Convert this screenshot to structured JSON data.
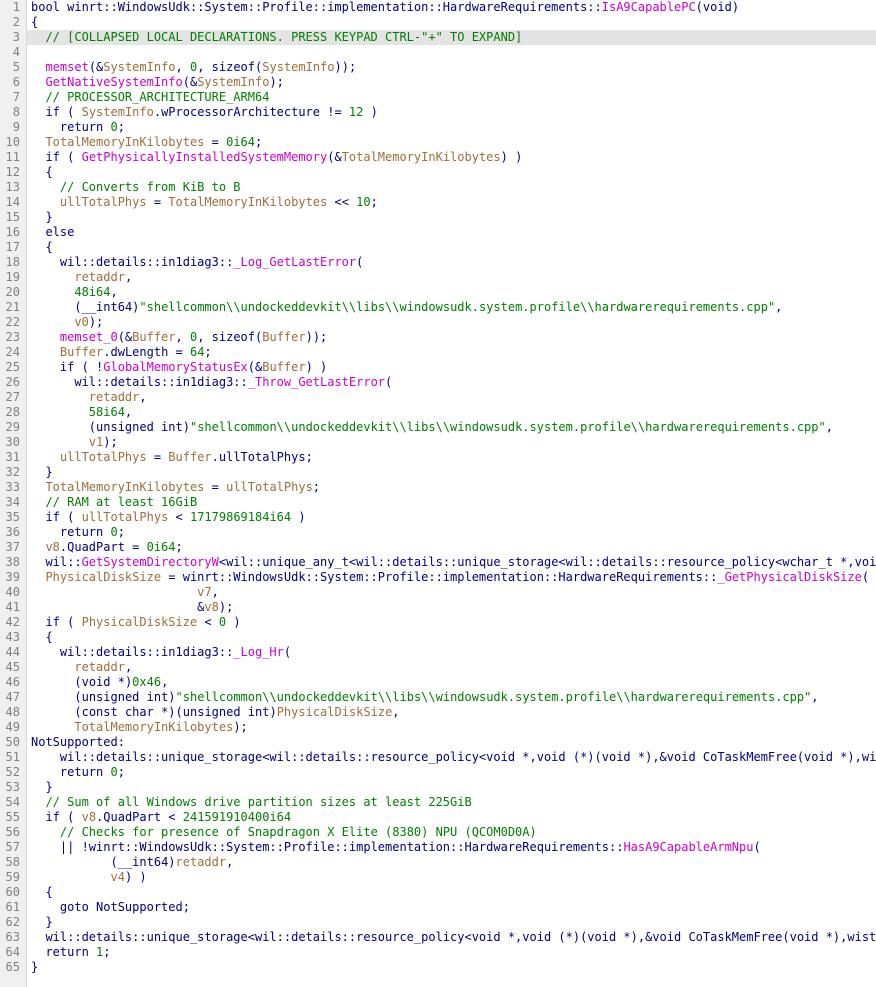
{
  "total_line_count": 65,
  "collapsed_line": 3,
  "lines": [
    {
      "n": 1,
      "ind": 0,
      "tokens": [
        {
          "t": "kw",
          "v": "bool "
        },
        {
          "t": "pl",
          "v": "winrt::WindowsUdk::System::Profile::implementation::HardwareRequirements::"
        },
        {
          "t": "fn",
          "v": "IsA9CapablePC"
        },
        {
          "t": "pl",
          "v": "("
        },
        {
          "t": "kw",
          "v": "void"
        },
        {
          "t": "pl",
          "v": ")"
        }
      ]
    },
    {
      "n": 2,
      "ind": 0,
      "tokens": [
        {
          "t": "pl",
          "v": "{"
        }
      ]
    },
    {
      "n": 3,
      "ind": 1,
      "collapsed": true,
      "tokens": [
        {
          "t": "cmt",
          "v": "// [COLLAPSED LOCAL DECLARATIONS. PRESS KEYPAD CTRL-\"+\" TO EXPAND]"
        }
      ]
    },
    {
      "n": 4,
      "ind": 0,
      "tokens": []
    },
    {
      "n": 5,
      "ind": 1,
      "tokens": [
        {
          "t": "fn",
          "v": "memset"
        },
        {
          "t": "pl",
          "v": "(&"
        },
        {
          "t": "var",
          "v": "SystemInfo"
        },
        {
          "t": "pl",
          "v": ", "
        },
        {
          "t": "num",
          "v": "0"
        },
        {
          "t": "pl",
          "v": ", "
        },
        {
          "t": "kw",
          "v": "sizeof"
        },
        {
          "t": "pl",
          "v": "("
        },
        {
          "t": "var",
          "v": "SystemInfo"
        },
        {
          "t": "pl",
          "v": "));"
        }
      ]
    },
    {
      "n": 6,
      "ind": 1,
      "tokens": [
        {
          "t": "fn",
          "v": "GetNativeSystemInfo"
        },
        {
          "t": "pl",
          "v": "(&"
        },
        {
          "t": "var",
          "v": "SystemInfo"
        },
        {
          "t": "pl",
          "v": ");"
        }
      ]
    },
    {
      "n": 7,
      "ind": 1,
      "tokens": [
        {
          "t": "cmt",
          "v": "// PROCESSOR_ARCHITECTURE_ARM64"
        }
      ]
    },
    {
      "n": 8,
      "ind": 1,
      "tokens": [
        {
          "t": "kw",
          "v": "if "
        },
        {
          "t": "pl",
          "v": "( "
        },
        {
          "t": "var",
          "v": "SystemInfo"
        },
        {
          "t": "pl",
          "v": ".wProcessorArchitecture != "
        },
        {
          "t": "num",
          "v": "12"
        },
        {
          "t": "pl",
          "v": " )"
        }
      ]
    },
    {
      "n": 9,
      "ind": 2,
      "tokens": [
        {
          "t": "kw",
          "v": "return "
        },
        {
          "t": "num",
          "v": "0"
        },
        {
          "t": "pl",
          "v": ";"
        }
      ]
    },
    {
      "n": 10,
      "ind": 1,
      "tokens": [
        {
          "t": "var",
          "v": "TotalMemoryInKilobytes"
        },
        {
          "t": "pl",
          "v": " = "
        },
        {
          "t": "num",
          "v": "0i64"
        },
        {
          "t": "pl",
          "v": ";"
        }
      ]
    },
    {
      "n": 11,
      "ind": 1,
      "tokens": [
        {
          "t": "kw",
          "v": "if "
        },
        {
          "t": "pl",
          "v": "( "
        },
        {
          "t": "fn",
          "v": "GetPhysicallyInstalledSystemMemory"
        },
        {
          "t": "pl",
          "v": "(&"
        },
        {
          "t": "var",
          "v": "TotalMemoryInKilobytes"
        },
        {
          "t": "pl",
          "v": ") )"
        }
      ]
    },
    {
      "n": 12,
      "ind": 1,
      "tokens": [
        {
          "t": "pl",
          "v": "{"
        }
      ]
    },
    {
      "n": 13,
      "ind": 2,
      "tokens": [
        {
          "t": "cmt",
          "v": "// Converts from KiB to B"
        }
      ]
    },
    {
      "n": 14,
      "ind": 2,
      "tokens": [
        {
          "t": "var",
          "v": "ullTotalPhys"
        },
        {
          "t": "pl",
          "v": " = "
        },
        {
          "t": "var",
          "v": "TotalMemoryInKilobytes"
        },
        {
          "t": "pl",
          "v": " << "
        },
        {
          "t": "num",
          "v": "10"
        },
        {
          "t": "pl",
          "v": ";"
        }
      ]
    },
    {
      "n": 15,
      "ind": 1,
      "tokens": [
        {
          "t": "pl",
          "v": "}"
        }
      ]
    },
    {
      "n": 16,
      "ind": 1,
      "tokens": [
        {
          "t": "kw",
          "v": "else"
        }
      ]
    },
    {
      "n": 17,
      "ind": 1,
      "tokens": [
        {
          "t": "pl",
          "v": "{"
        }
      ]
    },
    {
      "n": 18,
      "ind": 2,
      "tokens": [
        {
          "t": "pl",
          "v": "wil::details::in1diag3::"
        },
        {
          "t": "fn",
          "v": "_Log_GetLastError"
        },
        {
          "t": "pl",
          "v": "("
        }
      ]
    },
    {
      "n": 19,
      "ind": 3,
      "tokens": [
        {
          "t": "var",
          "v": "retaddr"
        },
        {
          "t": "pl",
          "v": ","
        }
      ]
    },
    {
      "n": 20,
      "ind": 3,
      "tokens": [
        {
          "t": "num",
          "v": "48i64"
        },
        {
          "t": "pl",
          "v": ","
        }
      ]
    },
    {
      "n": 21,
      "ind": 3,
      "tokens": [
        {
          "t": "pl",
          "v": "("
        },
        {
          "t": "type",
          "v": "__int64"
        },
        {
          "t": "pl",
          "v": ")"
        },
        {
          "t": "str",
          "v": "\"shellcommon\\\\undockeddevkit\\\\libs\\\\windowsudk.system.profile\\\\hardwarerequirements.cpp\""
        },
        {
          "t": "pl",
          "v": ","
        }
      ]
    },
    {
      "n": 22,
      "ind": 3,
      "tokens": [
        {
          "t": "var",
          "v": "v0"
        },
        {
          "t": "pl",
          "v": ");"
        }
      ]
    },
    {
      "n": 23,
      "ind": 2,
      "tokens": [
        {
          "t": "fn",
          "v": "memset_0"
        },
        {
          "t": "pl",
          "v": "(&"
        },
        {
          "t": "var",
          "v": "Buffer"
        },
        {
          "t": "pl",
          "v": ", "
        },
        {
          "t": "num",
          "v": "0"
        },
        {
          "t": "pl",
          "v": ", "
        },
        {
          "t": "kw",
          "v": "sizeof"
        },
        {
          "t": "pl",
          "v": "("
        },
        {
          "t": "var",
          "v": "Buffer"
        },
        {
          "t": "pl",
          "v": "));"
        }
      ]
    },
    {
      "n": 24,
      "ind": 2,
      "tokens": [
        {
          "t": "var",
          "v": "Buffer"
        },
        {
          "t": "pl",
          "v": ".dwLength = "
        },
        {
          "t": "num",
          "v": "64"
        },
        {
          "t": "pl",
          "v": ";"
        }
      ]
    },
    {
      "n": 25,
      "ind": 2,
      "tokens": [
        {
          "t": "kw",
          "v": "if "
        },
        {
          "t": "pl",
          "v": "( !"
        },
        {
          "t": "fn",
          "v": "GlobalMemoryStatusEx"
        },
        {
          "t": "pl",
          "v": "(&"
        },
        {
          "t": "var",
          "v": "Buffer"
        },
        {
          "t": "pl",
          "v": ") )"
        }
      ]
    },
    {
      "n": 26,
      "ind": 3,
      "tokens": [
        {
          "t": "pl",
          "v": "wil::details::in1diag3::"
        },
        {
          "t": "fn",
          "v": "_Throw_GetLastError"
        },
        {
          "t": "pl",
          "v": "("
        }
      ]
    },
    {
      "n": 27,
      "ind": 4,
      "tokens": [
        {
          "t": "var",
          "v": "retaddr"
        },
        {
          "t": "pl",
          "v": ","
        }
      ]
    },
    {
      "n": 28,
      "ind": 4,
      "tokens": [
        {
          "t": "num",
          "v": "58i64"
        },
        {
          "t": "pl",
          "v": ","
        }
      ]
    },
    {
      "n": 29,
      "ind": 4,
      "tokens": [
        {
          "t": "pl",
          "v": "("
        },
        {
          "t": "kw",
          "v": "unsigned int"
        },
        {
          "t": "pl",
          "v": ")"
        },
        {
          "t": "str",
          "v": "\"shellcommon\\\\undockeddevkit\\\\libs\\\\windowsudk.system.profile\\\\hardwarerequirements.cpp\""
        },
        {
          "t": "pl",
          "v": ","
        }
      ]
    },
    {
      "n": 30,
      "ind": 4,
      "tokens": [
        {
          "t": "var",
          "v": "v1"
        },
        {
          "t": "pl",
          "v": ");"
        }
      ]
    },
    {
      "n": 31,
      "ind": 2,
      "tokens": [
        {
          "t": "var",
          "v": "ullTotalPhys"
        },
        {
          "t": "pl",
          "v": " = "
        },
        {
          "t": "var",
          "v": "Buffer"
        },
        {
          "t": "pl",
          "v": ".ullTotalPhys;"
        }
      ]
    },
    {
      "n": 32,
      "ind": 1,
      "tokens": [
        {
          "t": "pl",
          "v": "}"
        }
      ]
    },
    {
      "n": 33,
      "ind": 1,
      "tokens": [
        {
          "t": "var",
          "v": "TotalMemoryInKilobytes"
        },
        {
          "t": "pl",
          "v": " = "
        },
        {
          "t": "var",
          "v": "ullTotalPhys"
        },
        {
          "t": "pl",
          "v": ";"
        }
      ]
    },
    {
      "n": 34,
      "ind": 1,
      "tokens": [
        {
          "t": "cmt",
          "v": "// RAM at least 16GiB"
        }
      ]
    },
    {
      "n": 35,
      "ind": 1,
      "tokens": [
        {
          "t": "kw",
          "v": "if "
        },
        {
          "t": "pl",
          "v": "( "
        },
        {
          "t": "var",
          "v": "ullTotalPhys"
        },
        {
          "t": "pl",
          "v": " < "
        },
        {
          "t": "num",
          "v": "17179869184i64"
        },
        {
          "t": "pl",
          "v": " )"
        }
      ]
    },
    {
      "n": 36,
      "ind": 2,
      "tokens": [
        {
          "t": "kw",
          "v": "return "
        },
        {
          "t": "num",
          "v": "0"
        },
        {
          "t": "pl",
          "v": ";"
        }
      ]
    },
    {
      "n": 37,
      "ind": 1,
      "tokens": [
        {
          "t": "var",
          "v": "v8"
        },
        {
          "t": "pl",
          "v": ".QuadPart = "
        },
        {
          "t": "num",
          "v": "0i64"
        },
        {
          "t": "pl",
          "v": ";"
        }
      ]
    },
    {
      "n": 38,
      "ind": 1,
      "tokens": [
        {
          "t": "pl",
          "v": "wil::"
        },
        {
          "t": "fn",
          "v": "GetSystemDirectoryW"
        },
        {
          "t": "pl",
          "v": "<wil::unique_any_t<wil::details::unique_storage<wil::details::resource_policy<wchar_t *,void (*)"
        }
      ]
    },
    {
      "n": 39,
      "ind": 1,
      "tokens": [
        {
          "t": "var",
          "v": "PhysicalDiskSize"
        },
        {
          "t": "pl",
          "v": " = winrt::WindowsUdk::System::Profile::implementation::HardwareRequirements::"
        },
        {
          "t": "fn",
          "v": "_GetPhysicalDiskSize"
        },
        {
          "t": "pl",
          "v": "("
        }
      ]
    },
    {
      "n": 40,
      "ind": 0,
      "raw": "                       ",
      "tokens": [
        {
          "t": "var",
          "v": "v7"
        },
        {
          "t": "pl",
          "v": ","
        }
      ]
    },
    {
      "n": 41,
      "ind": 0,
      "raw": "                       ",
      "tokens": [
        {
          "t": "pl",
          "v": "&"
        },
        {
          "t": "var",
          "v": "v8"
        },
        {
          "t": "pl",
          "v": ");"
        }
      ]
    },
    {
      "n": 42,
      "ind": 1,
      "tokens": [
        {
          "t": "kw",
          "v": "if "
        },
        {
          "t": "pl",
          "v": "( "
        },
        {
          "t": "var",
          "v": "PhysicalDiskSize"
        },
        {
          "t": "pl",
          "v": " < "
        },
        {
          "t": "num",
          "v": "0"
        },
        {
          "t": "pl",
          "v": " )"
        }
      ]
    },
    {
      "n": 43,
      "ind": 1,
      "tokens": [
        {
          "t": "pl",
          "v": "{"
        }
      ]
    },
    {
      "n": 44,
      "ind": 2,
      "tokens": [
        {
          "t": "pl",
          "v": "wil::details::in1diag3::"
        },
        {
          "t": "fn",
          "v": "_Log_Hr"
        },
        {
          "t": "pl",
          "v": "("
        }
      ]
    },
    {
      "n": 45,
      "ind": 3,
      "tokens": [
        {
          "t": "var",
          "v": "retaddr"
        },
        {
          "t": "pl",
          "v": ","
        }
      ]
    },
    {
      "n": 46,
      "ind": 3,
      "tokens": [
        {
          "t": "pl",
          "v": "("
        },
        {
          "t": "kw",
          "v": "void "
        },
        {
          "t": "pl",
          "v": "*)"
        },
        {
          "t": "num",
          "v": "0x46"
        },
        {
          "t": "pl",
          "v": ","
        }
      ]
    },
    {
      "n": 47,
      "ind": 3,
      "tokens": [
        {
          "t": "pl",
          "v": "("
        },
        {
          "t": "kw",
          "v": "unsigned int"
        },
        {
          "t": "pl",
          "v": ")"
        },
        {
          "t": "str",
          "v": "\"shellcommon\\\\undockeddevkit\\\\libs\\\\windowsudk.system.profile\\\\hardwarerequirements.cpp\""
        },
        {
          "t": "pl",
          "v": ","
        }
      ]
    },
    {
      "n": 48,
      "ind": 3,
      "tokens": [
        {
          "t": "pl",
          "v": "("
        },
        {
          "t": "kw",
          "v": "const char "
        },
        {
          "t": "pl",
          "v": "*)("
        },
        {
          "t": "kw",
          "v": "unsigned int"
        },
        {
          "t": "pl",
          "v": ")"
        },
        {
          "t": "var",
          "v": "PhysicalDiskSize"
        },
        {
          "t": "pl",
          "v": ","
        }
      ]
    },
    {
      "n": 49,
      "ind": 3,
      "tokens": [
        {
          "t": "var",
          "v": "TotalMemoryInKilobytes"
        },
        {
          "t": "pl",
          "v": ");"
        }
      ]
    },
    {
      "n": 50,
      "ind": 0,
      "tokens": [
        {
          "t": "lbl",
          "v": "NotSupported"
        },
        {
          "t": "pl",
          "v": ":"
        }
      ]
    },
    {
      "n": 51,
      "ind": 2,
      "tokens": [
        {
          "t": "pl",
          "v": "wil::details::unique_storage<wil::details::resource_policy<void *,void (*)(void *),&void CoTaskMemFree(void *),wistd::"
        }
      ]
    },
    {
      "n": 52,
      "ind": 2,
      "tokens": [
        {
          "t": "kw",
          "v": "return "
        },
        {
          "t": "num",
          "v": "0"
        },
        {
          "t": "pl",
          "v": ";"
        }
      ]
    },
    {
      "n": 53,
      "ind": 1,
      "tokens": [
        {
          "t": "pl",
          "v": "}"
        }
      ]
    },
    {
      "n": 54,
      "ind": 1,
      "tokens": [
        {
          "t": "cmt",
          "v": "// Sum of all Windows drive partition sizes at least 225GiB"
        }
      ]
    },
    {
      "n": 55,
      "ind": 1,
      "tokens": [
        {
          "t": "kw",
          "v": "if "
        },
        {
          "t": "pl",
          "v": "( "
        },
        {
          "t": "var",
          "v": "v8"
        },
        {
          "t": "pl",
          "v": ".QuadPart < "
        },
        {
          "t": "num",
          "v": "241591910400i64"
        }
      ]
    },
    {
      "n": 56,
      "ind": 2,
      "tokens": [
        {
          "t": "cmt",
          "v": "// Checks for presence of Snapdragon X Elite (8380) NPU (QCOM0D0A)"
        }
      ]
    },
    {
      "n": 57,
      "ind": 2,
      "tokens": [
        {
          "t": "pl",
          "v": "|| !winrt::WindowsUdk::System::Profile::implementation::HardwareRequirements::"
        },
        {
          "t": "fn",
          "v": "HasA9CapableArmNpu"
        },
        {
          "t": "pl",
          "v": "("
        }
      ]
    },
    {
      "n": 58,
      "ind": 0,
      "raw": "           ",
      "tokens": [
        {
          "t": "pl",
          "v": "("
        },
        {
          "t": "type",
          "v": "__int64"
        },
        {
          "t": "pl",
          "v": ")"
        },
        {
          "t": "var",
          "v": "retaddr"
        },
        {
          "t": "pl",
          "v": ","
        }
      ]
    },
    {
      "n": 59,
      "ind": 0,
      "raw": "           ",
      "tokens": [
        {
          "t": "var",
          "v": "v4"
        },
        {
          "t": "pl",
          "v": ") )"
        }
      ]
    },
    {
      "n": 60,
      "ind": 1,
      "tokens": [
        {
          "t": "pl",
          "v": "{"
        }
      ]
    },
    {
      "n": 61,
      "ind": 2,
      "tokens": [
        {
          "t": "kw",
          "v": "goto "
        },
        {
          "t": "pl",
          "v": "NotSupported;"
        }
      ]
    },
    {
      "n": 62,
      "ind": 1,
      "tokens": [
        {
          "t": "pl",
          "v": "}"
        }
      ]
    },
    {
      "n": 63,
      "ind": 1,
      "tokens": [
        {
          "t": "pl",
          "v": "wil::details::unique_storage<wil::details::resource_policy<void *,void (*)(void *),&void CoTaskMemFree(void *),wistd::in"
        }
      ]
    },
    {
      "n": 64,
      "ind": 1,
      "tokens": [
        {
          "t": "kw",
          "v": "return "
        },
        {
          "t": "num",
          "v": "1"
        },
        {
          "t": "pl",
          "v": ";"
        }
      ]
    },
    {
      "n": 65,
      "ind": 0,
      "tokens": [
        {
          "t": "pl",
          "v": "}"
        }
      ]
    }
  ]
}
